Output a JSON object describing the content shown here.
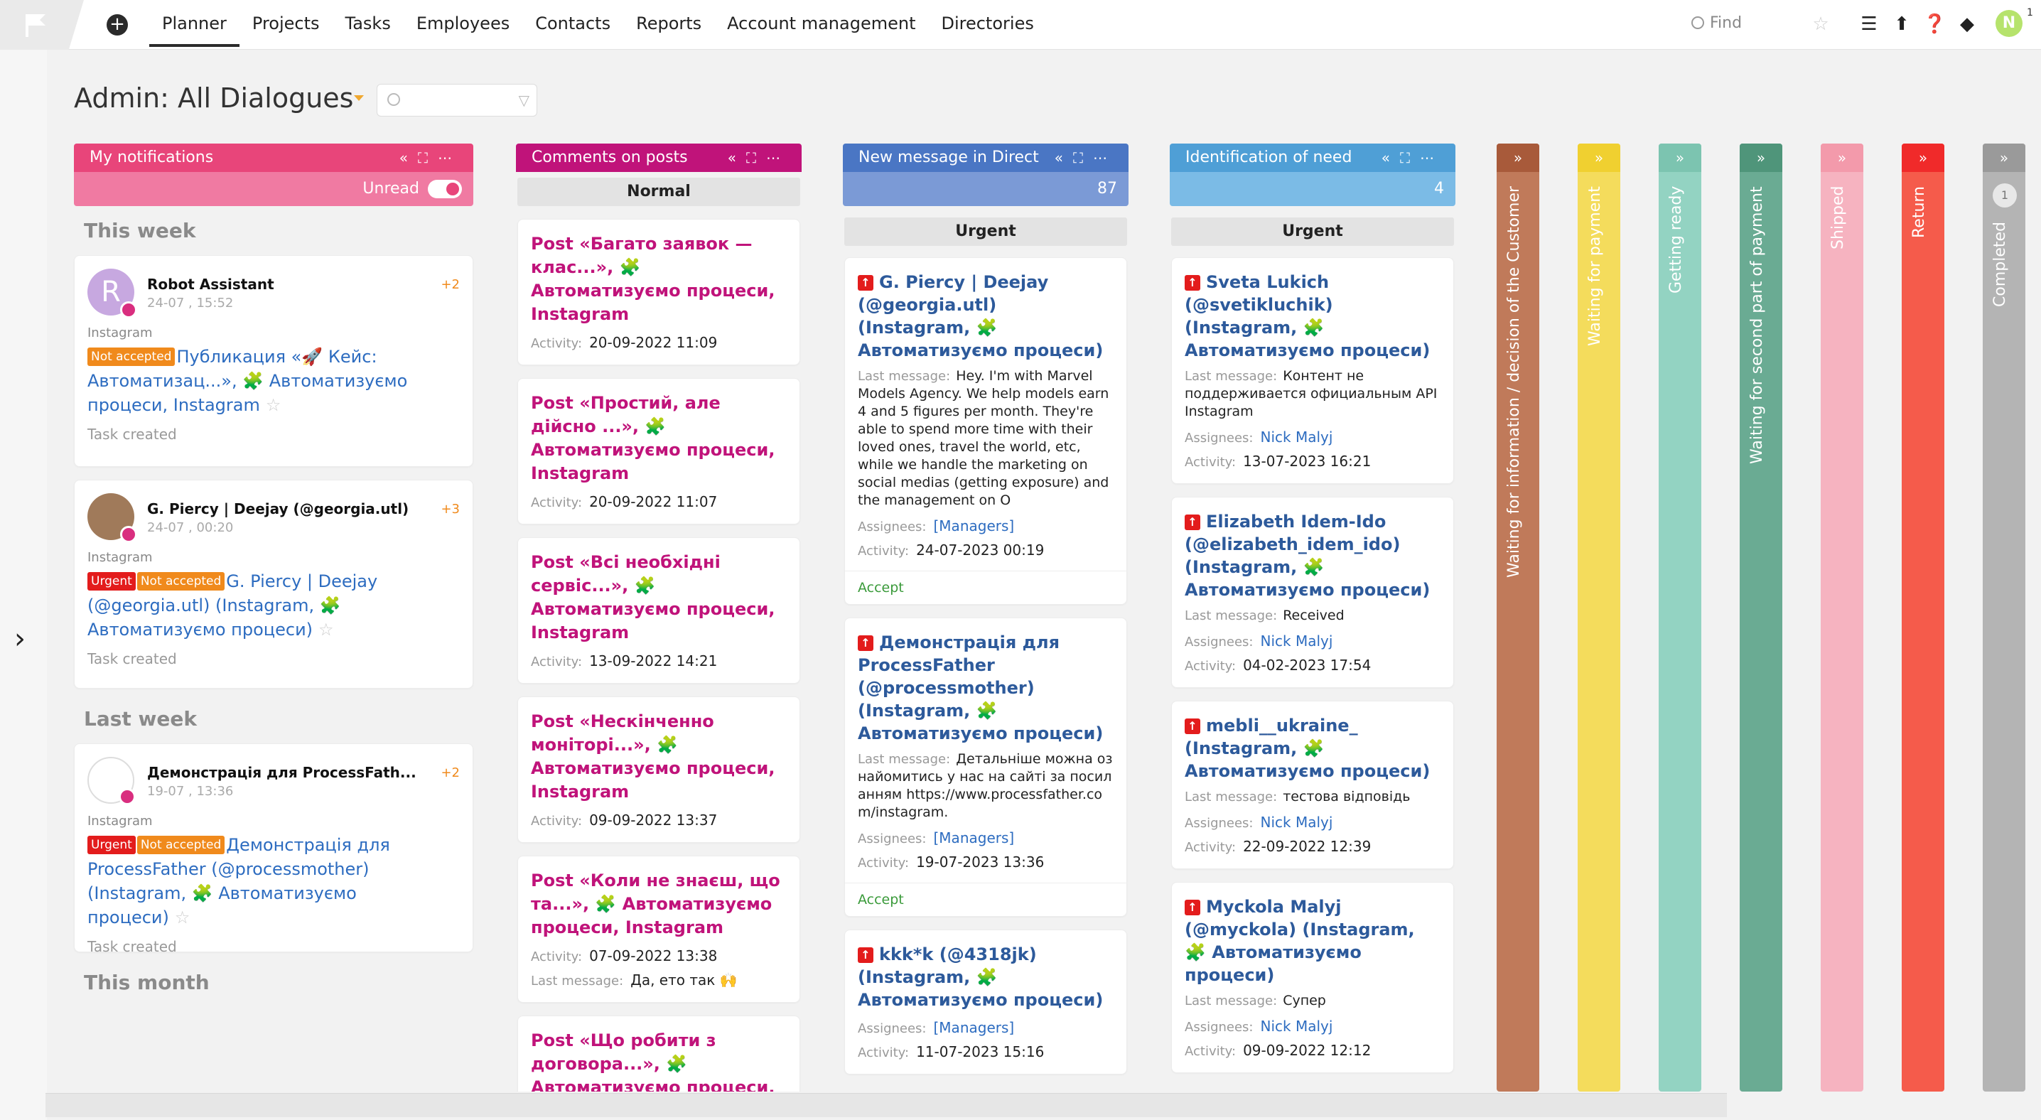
{
  "nav": {
    "items": [
      {
        "label": "Planner",
        "active": true
      },
      {
        "label": "Projects"
      },
      {
        "label": "Tasks"
      },
      {
        "label": "Employees"
      },
      {
        "label": "Contacts"
      },
      {
        "label": "Reports"
      },
      {
        "label": "Account management"
      },
      {
        "label": "Directories"
      }
    ],
    "find_label": "Find",
    "avatar_letter": "N",
    "avatar_badge": "1"
  },
  "board": {
    "title": "Admin: All Dialogues"
  },
  "columns": {
    "notifications": {
      "title": "My notifications",
      "color": "#e8457a",
      "toggle_label": "Unread",
      "sections": {
        "this_week": "This week",
        "last_week": "Last week",
        "this_month": "This month"
      },
      "cards": [
        {
          "name": "Robot Assistant",
          "date": "24-07 , 15:52",
          "count": "+2",
          "source": "Instagram",
          "badges": [
            "Not accepted"
          ],
          "text": "Публикация «🚀 Кейс: Автоматизац...», 🧩 Автоматизуємо процеси, Instagram",
          "footer": "Task created"
        },
        {
          "name": "G. Piercy | Deejay (@georgia.utl)",
          "date": "24-07 , 00:20",
          "count": "+3",
          "source": "Instagram",
          "badges": [
            "Urgent",
            "Not accepted"
          ],
          "text": "G. Piercy | Deejay (@georgia.utl) (Instagram, 🧩 Автоматизуємо процеси)",
          "footer": "Task created"
        },
        {
          "name": "Демонстрація для ProcessFath...",
          "date": "19-07 , 13:36",
          "count": "+2",
          "source": "Instagram",
          "badges": [
            "Urgent",
            "Not accepted"
          ],
          "text": "Демонстрація для ProcessFather (@processmother) (Instagram, 🧩 Автоматизуємо процеси)",
          "footer": "Task created"
        }
      ]
    },
    "comments": {
      "title": "Comments on posts",
      "color": "#c0137a",
      "group": "Normal",
      "cards": [
        {
          "title": "Post «Багато заявок — клас...», 🧩 Автоматизуємо процеси, Instagram",
          "activity": "20-09-2022 11:09"
        },
        {
          "title": "Post «Простий, але дійсно ...», 🧩 Автоматизуємо процеси, Instagram",
          "activity": "20-09-2022 11:07"
        },
        {
          "title": "Post «Всі необхідні сервіс...», 🧩 Автоматизуємо процеси, Instagram",
          "activity": "13-09-2022 14:21"
        },
        {
          "title": "Post «Нескінченно моніторі...», 🧩 Автоматизуємо процеси, Instagram",
          "activity": "09-09-2022 13:37"
        },
        {
          "title": "Post «Коли не знаєш, що та...», 🧩 Автоматизуємо процеси, Instagram",
          "activity": "07-09-2022 13:38",
          "last_message": "Да, ето так 🙌"
        },
        {
          "title": "Post «Що робити з договора...», 🧩 Автоматизуємо процеси, Instagram"
        }
      ]
    },
    "direct": {
      "title": "New message in Direct",
      "color": "#4a76c4",
      "count": "87",
      "group": "Urgent",
      "cards": [
        {
          "title": "G. Piercy | Deejay (@georgia.utl) (Instagram, 🧩 Автоматизуємо процеси)",
          "last_message": "Hey. I'm with Marvel Models Agency. We help models earn 4 and 5 figures per month. They're able to spend more time with their loved ones, travel the world, etc, while we handle the marketing on social medias (getting exposure) and the management on O",
          "assignees": "[Managers]",
          "activity": "24-07-2023 00:19",
          "action": "Accept"
        },
        {
          "title": "Демонстрація для ProcessFather (@processmother) (Instagram, 🧩 Автоматизуємо процеси)",
          "last_message": "Детальніше можна ознайомитись у нас на сайті за посиланням https://www.processfather.com/instagram.",
          "assignees": "[Managers]",
          "activity": "19-07-2023 13:36",
          "action": "Accept"
        },
        {
          "title": "kkk*k (@4318jk) (Instagram, 🧩 Автоматизуємо процеси)",
          "assignees": "[Managers]",
          "activity": "11-07-2023 15:16"
        }
      ]
    },
    "identification": {
      "title": "Identification of need",
      "color": "#4f9fd6",
      "count": "4",
      "group": "Urgent",
      "cards": [
        {
          "title": "Sveta Lukich (@svetikluchik) (Instagram, 🧩 Автоматизуємо процеси)",
          "last_message": "Контент не поддерживается официальным API Instagram",
          "assignees": "Nick Malyj",
          "activity": "13-07-2023 16:21"
        },
        {
          "title": "Elizabeth Idem-Ido (@elizabeth_idem_ido) (Instagram, 🧩 Автоматизуємо процеси)",
          "last_message": "Received",
          "assignees": "Nick Malyj",
          "activity": "04-02-2023 17:54"
        },
        {
          "title": "mebli__ukraine_ (Instagram, 🧩 Автоматизуємо процеси)",
          "last_message": "тестова відповідь",
          "assignees": "Nick Malyj",
          "activity": "22-09-2022 12:39"
        },
        {
          "title": "Myckola Malyj (@myckola) (Instagram, 🧩 Автоматизуємо процеси)",
          "last_message": "Супер",
          "assignees": "Nick Malyj",
          "activity": "09-09-2022 12:12"
        }
      ]
    }
  },
  "labels": {
    "activity": "Activity:",
    "last_message": "Last message:",
    "assignees": "Assignees:"
  },
  "collapsed_columns": [
    {
      "label": "Waiting for information / decision of the Customer",
      "color": "#c07a5a"
    },
    {
      "label": "Waiting for payment",
      "color": "#f4dc5c"
    },
    {
      "label": "Getting ready",
      "color": "#93d3c2"
    },
    {
      "label": "Waiting for second part of payment",
      "color": "#6aab93"
    },
    {
      "label": "Shipped",
      "color": "#f6b3c0"
    },
    {
      "label": "Return",
      "color": "#f55b4b"
    },
    {
      "label": "Completed",
      "color": "#b4b4b4",
      "count": "1"
    }
  ]
}
